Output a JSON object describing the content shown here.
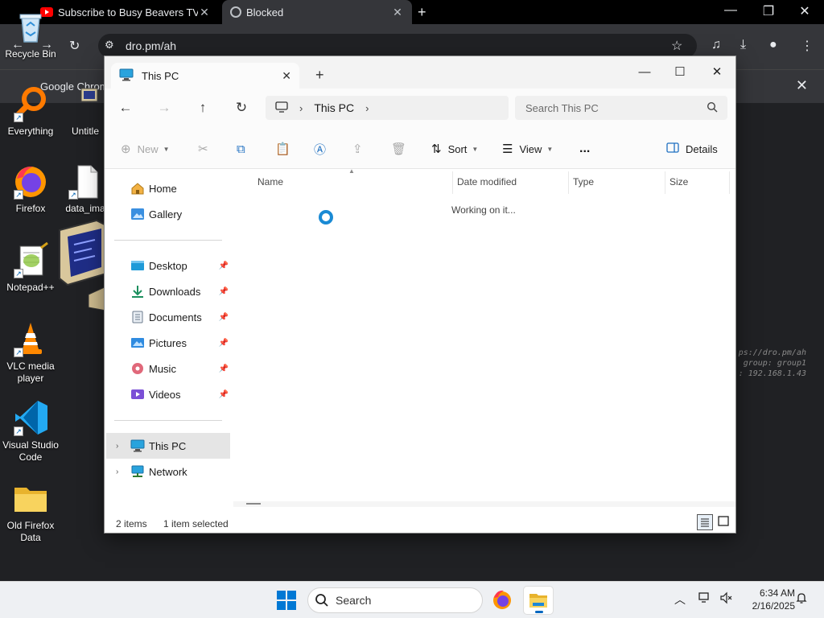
{
  "browser": {
    "tabs": [
      {
        "title": "Subscribe to Busy Beavers TV fo",
        "icon": "youtube-icon"
      },
      {
        "title": "Blocked",
        "icon": "globe-icon"
      }
    ],
    "url": "dro.pm/ah",
    "infobar_text": "Google Chrom",
    "background_text": [
      "ps://dro.pm/ah",
      "group: group1",
      ": 192.168.1.43"
    ]
  },
  "desktop": {
    "icons": [
      {
        "label": "Recycle Bin"
      },
      {
        "label": "Everything"
      },
      {
        "label": "Untitle"
      },
      {
        "label": "Firefox"
      },
      {
        "label": "data_ima"
      },
      {
        "label": "Notepad++"
      },
      {
        "label": "VLC media player"
      },
      {
        "label": "Visual Studio Code"
      },
      {
        "label": "Old Firefox Data"
      }
    ]
  },
  "explorer": {
    "tab_title": "This PC",
    "path": {
      "root_icon": "monitor-icon",
      "segment": "This PC"
    },
    "search_placeholder": "Search This PC",
    "commands": {
      "new": "New",
      "sort": "Sort",
      "view": "View",
      "more": "...",
      "details": "Details"
    },
    "nav": {
      "top": [
        {
          "label": "Home",
          "icon": "home-icon"
        },
        {
          "label": "Gallery",
          "icon": "gallery-icon"
        }
      ],
      "quick_access": [
        {
          "label": "Desktop",
          "icon": "desktop-folder-icon"
        },
        {
          "label": "Downloads",
          "icon": "downloads-icon"
        },
        {
          "label": "Documents",
          "icon": "documents-icon"
        },
        {
          "label": "Pictures",
          "icon": "pictures-icon"
        },
        {
          "label": "Music",
          "icon": "music-icon"
        },
        {
          "label": "Videos",
          "icon": "videos-icon"
        }
      ],
      "bottom": [
        {
          "label": "This PC",
          "icon": "this-pc-icon",
          "selected": true
        },
        {
          "label": "Network",
          "icon": "network-icon",
          "selected": false
        }
      ]
    },
    "columns": [
      "Name",
      "Date modified",
      "Type",
      "Size"
    ],
    "status_message": "Working on it...",
    "status_bar": {
      "items": "2 items",
      "selected": "1 item selected"
    }
  },
  "taskbar": {
    "search_placeholder": "Search",
    "time": "6:34 AM",
    "date": "2/16/2025"
  },
  "colors": {
    "accent": "#0078d4",
    "explorer_bg": "#ffffff",
    "taskbar_bg": "#eef0f3",
    "browser_bg": "#202124"
  }
}
